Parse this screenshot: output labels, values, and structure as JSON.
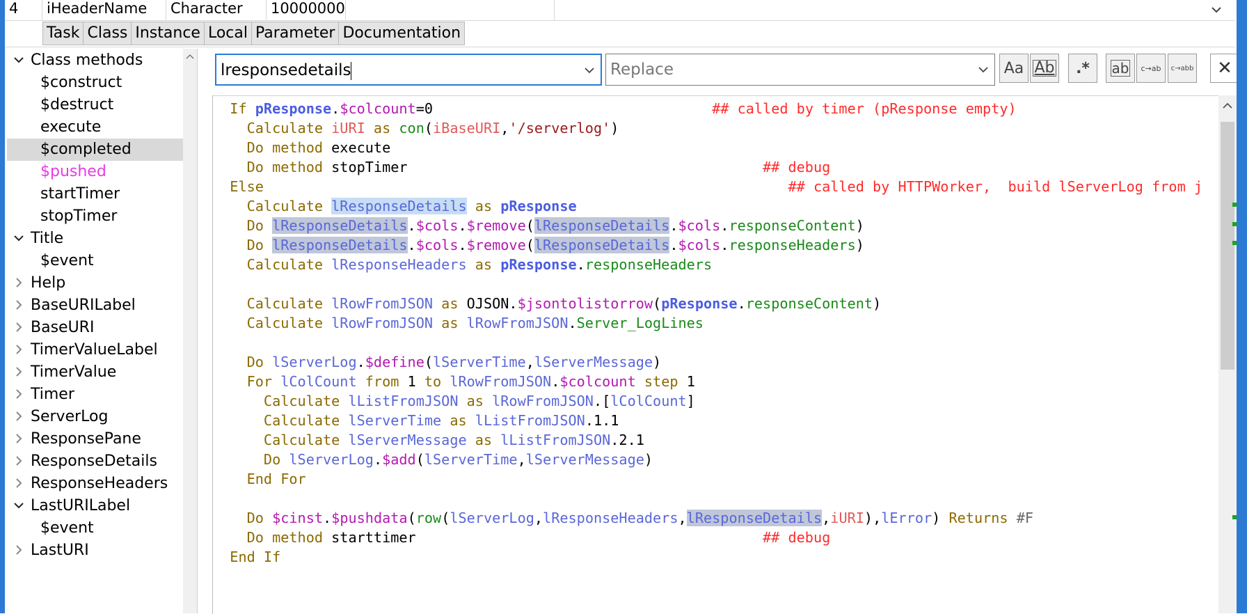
{
  "variable_row": {
    "number": "4",
    "name": "iHeaderName",
    "type": "Character",
    "value": "10000000"
  },
  "tabs": [
    "Task",
    "Class",
    "Instance",
    "Local",
    "Parameter",
    "Documentation"
  ],
  "tree": [
    {
      "label": "Class methods",
      "expander": "expanded",
      "level": 0
    },
    {
      "label": "$construct",
      "level": 1
    },
    {
      "label": "$destruct",
      "level": 1
    },
    {
      "label": "execute",
      "level": 1
    },
    {
      "label": "$completed",
      "level": 1,
      "selected": true
    },
    {
      "label": "$pushed",
      "level": 1,
      "color": "#e83ae8"
    },
    {
      "label": "startTimer",
      "level": 1
    },
    {
      "label": "stopTimer",
      "level": 1
    },
    {
      "label": "Title",
      "expander": "expanded",
      "level": 0
    },
    {
      "label": "$event",
      "level": 1
    },
    {
      "label": "Help",
      "expander": "collapsed",
      "level": 0
    },
    {
      "label": "BaseURILabel",
      "expander": "collapsed",
      "level": 0
    },
    {
      "label": "BaseURI",
      "expander": "collapsed",
      "level": 0
    },
    {
      "label": "TimerValueLabel",
      "expander": "collapsed",
      "level": 0
    },
    {
      "label": "TimerValue",
      "expander": "collapsed",
      "level": 0
    },
    {
      "label": "Timer",
      "expander": "collapsed",
      "level": 0
    },
    {
      "label": "ServerLog",
      "expander": "collapsed",
      "level": 0
    },
    {
      "label": "ResponsePane",
      "expander": "collapsed",
      "level": 0
    },
    {
      "label": "ResponseDetails",
      "expander": "collapsed",
      "level": 0
    },
    {
      "label": "ResponseHeaders",
      "expander": "collapsed",
      "level": 0
    },
    {
      "label": "LastURILabel",
      "expander": "expanded",
      "level": 0
    },
    {
      "label": "$event",
      "level": 1
    },
    {
      "label": "LastURI",
      "expander": "collapsed",
      "level": 0
    }
  ],
  "find": {
    "search_value": "lresponsedetails",
    "replace_placeholder": "Replace",
    "buttons": [
      {
        "name": "match-case-button",
        "glyph": "Aa"
      },
      {
        "name": "whole-word-button",
        "glyph": "Ab"
      },
      {
        "name": "regex-button",
        "glyph": ".*"
      },
      {
        "name": "replace-next-button",
        "glyph": "ab"
      },
      {
        "name": "replace-button",
        "glyph": "c→ab"
      },
      {
        "name": "replace-all-button",
        "glyph": "c→abb"
      }
    ],
    "close_glyph": "✕"
  },
  "code_lines": [
    [
      [
        "kw",
        "  If "
      ],
      [
        "pvar",
        "pResponse"
      ],
      [
        "txt",
        "."
      ],
      [
        "meth",
        "$colcount"
      ],
      [
        "txt",
        "=0"
      ],
      [
        "pad",
        "                                 "
      ],
      [
        "cmt",
        "## called by timer (pResponse empty)"
      ]
    ],
    [
      [
        "kw",
        "    Calculate "
      ],
      [
        "ivar",
        "iURI"
      ],
      [
        "kw",
        " as "
      ],
      [
        "fld",
        "con"
      ],
      [
        "txt",
        "("
      ],
      [
        "ivar",
        "iBaseURI"
      ],
      [
        "txt",
        ","
      ],
      [
        "str",
        "'/serverlog'"
      ],
      [
        "txt",
        ")"
      ]
    ],
    [
      [
        "kw",
        "    Do method "
      ],
      [
        "txt",
        "execute"
      ]
    ],
    [
      [
        "kw",
        "    Do method "
      ],
      [
        "txt",
        "stopTimer"
      ],
      [
        "pad",
        "                                          "
      ],
      [
        "cmt",
        "## debug"
      ]
    ],
    [
      [
        "kw",
        "  Else"
      ],
      [
        "pad",
        "                                                              "
      ],
      [
        "cmt",
        "## called by HTTPWorker,  build lServerLog from j"
      ]
    ],
    [
      [
        "kw",
        "    Calculate "
      ],
      [
        "var hl-blue",
        "lResponseDetails"
      ],
      [
        "kw",
        " as "
      ],
      [
        "pvar",
        "pResponse"
      ]
    ],
    [
      [
        "kw",
        "    Do "
      ],
      [
        "var hl",
        "lResponseDetails"
      ],
      [
        "txt",
        "."
      ],
      [
        "meth",
        "$cols"
      ],
      [
        "txt",
        "."
      ],
      [
        "meth",
        "$remove"
      ],
      [
        "txt",
        "("
      ],
      [
        "var hl",
        "lResponseDetails"
      ],
      [
        "txt",
        "."
      ],
      [
        "meth",
        "$cols"
      ],
      [
        "txt",
        "."
      ],
      [
        "fld",
        "responseContent"
      ],
      [
        "txt",
        ")"
      ]
    ],
    [
      [
        "kw",
        "    Do "
      ],
      [
        "var hl",
        "lResponseDetails"
      ],
      [
        "txt",
        "."
      ],
      [
        "meth",
        "$cols"
      ],
      [
        "txt",
        "."
      ],
      [
        "meth",
        "$remove"
      ],
      [
        "txt",
        "("
      ],
      [
        "var hl",
        "lResponseDetails"
      ],
      [
        "txt",
        "."
      ],
      [
        "meth",
        "$cols"
      ],
      [
        "txt",
        "."
      ],
      [
        "fld",
        "responseHeaders"
      ],
      [
        "txt",
        ")"
      ]
    ],
    [
      [
        "kw",
        "    Calculate "
      ],
      [
        "var",
        "lResponseHeaders"
      ],
      [
        "kw",
        " as "
      ],
      [
        "pvar",
        "pResponse"
      ],
      [
        "txt",
        "."
      ],
      [
        "fld",
        "responseHeaders"
      ]
    ],
    [],
    [
      [
        "kw",
        "    Calculate "
      ],
      [
        "var",
        "lRowFromJSON"
      ],
      [
        "kw",
        " as "
      ],
      [
        "txt",
        "OJSON."
      ],
      [
        "meth",
        "$jsontolistorrow"
      ],
      [
        "txt",
        "("
      ],
      [
        "pvar",
        "pResponse"
      ],
      [
        "txt",
        "."
      ],
      [
        "fld",
        "responseContent"
      ],
      [
        "txt",
        ")"
      ]
    ],
    [
      [
        "kw",
        "    Calculate "
      ],
      [
        "var",
        "lRowFromJSON"
      ],
      [
        "kw",
        " as "
      ],
      [
        "var",
        "lRowFromJSON"
      ],
      [
        "txt",
        "."
      ],
      [
        "fld",
        "Server_LogLines"
      ]
    ],
    [],
    [
      [
        "kw",
        "    Do "
      ],
      [
        "var",
        "lServerLog"
      ],
      [
        "txt",
        "."
      ],
      [
        "meth",
        "$define"
      ],
      [
        "txt",
        "("
      ],
      [
        "var",
        "lServerTime"
      ],
      [
        "txt",
        ","
      ],
      [
        "var",
        "lServerMessage"
      ],
      [
        "txt",
        ")"
      ]
    ],
    [
      [
        "kw",
        "    For "
      ],
      [
        "var",
        "lColCount"
      ],
      [
        "kw",
        " from "
      ],
      [
        "txt",
        "1"
      ],
      [
        "kw",
        " to "
      ],
      [
        "var",
        "lRowFromJSON"
      ],
      [
        "txt",
        "."
      ],
      [
        "meth",
        "$colcount"
      ],
      [
        "kw",
        " step "
      ],
      [
        "txt",
        "1"
      ]
    ],
    [
      [
        "kw",
        "      Calculate "
      ],
      [
        "var",
        "lListFromJSON"
      ],
      [
        "kw",
        " as "
      ],
      [
        "var",
        "lRowFromJSON"
      ],
      [
        "txt",
        ".["
      ],
      [
        "var",
        "lColCount"
      ],
      [
        "txt",
        "]"
      ]
    ],
    [
      [
        "kw",
        "      Calculate "
      ],
      [
        "var",
        "lServerTime"
      ],
      [
        "kw",
        " as "
      ],
      [
        "var",
        "lListFromJSON"
      ],
      [
        "txt",
        ".1.1"
      ]
    ],
    [
      [
        "kw",
        "      Calculate "
      ],
      [
        "var",
        "lServerMessage"
      ],
      [
        "kw",
        " as "
      ],
      [
        "var",
        "lListFromJSON"
      ],
      [
        "txt",
        ".2.1"
      ]
    ],
    [
      [
        "kw",
        "      Do "
      ],
      [
        "var",
        "lServerLog"
      ],
      [
        "txt",
        "."
      ],
      [
        "meth",
        "$add"
      ],
      [
        "txt",
        "("
      ],
      [
        "var",
        "lServerTime"
      ],
      [
        "txt",
        ","
      ],
      [
        "var",
        "lServerMessage"
      ],
      [
        "txt",
        ")"
      ]
    ],
    [
      [
        "kw",
        "    End For"
      ]
    ],
    [],
    [
      [
        "kw",
        "    Do "
      ],
      [
        "meth",
        "$cinst"
      ],
      [
        "txt",
        "."
      ],
      [
        "meth",
        "$pushdata"
      ],
      [
        "txt",
        "("
      ],
      [
        "fld",
        "row"
      ],
      [
        "txt",
        "("
      ],
      [
        "var",
        "lServerLog"
      ],
      [
        "txt",
        ","
      ],
      [
        "var",
        "lResponseHeaders"
      ],
      [
        "txt",
        ","
      ],
      [
        "var hl",
        "lResponseDetails"
      ],
      [
        "txt",
        ","
      ],
      [
        "ivar",
        "iURI"
      ],
      [
        "txt",
        "),"
      ],
      [
        "var",
        "lError"
      ],
      [
        "txt",
        ")"
      ],
      [
        "kw",
        " Returns "
      ],
      [
        "gray",
        "#F"
      ]
    ],
    [
      [
        "kw",
        "    Do method "
      ],
      [
        "txt",
        "starttimer"
      ],
      [
        "pad",
        "                                         "
      ],
      [
        "cmt",
        "## debug"
      ]
    ],
    [
      [
        "kw",
        "  End If"
      ]
    ]
  ]
}
